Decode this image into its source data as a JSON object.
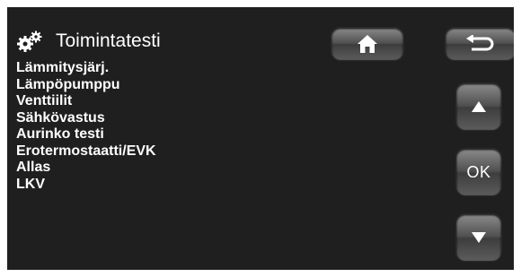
{
  "header": {
    "title": "Toimintatesti",
    "title_icon": "gears-icon"
  },
  "menu": {
    "items": [
      {
        "label": "Lämmitysjärj."
      },
      {
        "label": "Lämpöpumppu"
      },
      {
        "label": "Venttiilit"
      },
      {
        "label": "Sähkövastus"
      },
      {
        "label": "Aurinko testi"
      },
      {
        "label": "Erotermostaatti/EVK"
      },
      {
        "label": "Allas"
      },
      {
        "label": "LKV"
      }
    ]
  },
  "buttons": {
    "home_icon": "home-icon",
    "back_icon": "back-arrow-icon",
    "up_icon": "triangle-up-icon",
    "ok_label": "OK",
    "down_icon": "triangle-down-icon"
  },
  "colors": {
    "background": "#1f1f1f",
    "text": "#ffffff",
    "button": "#5a5a5a"
  }
}
